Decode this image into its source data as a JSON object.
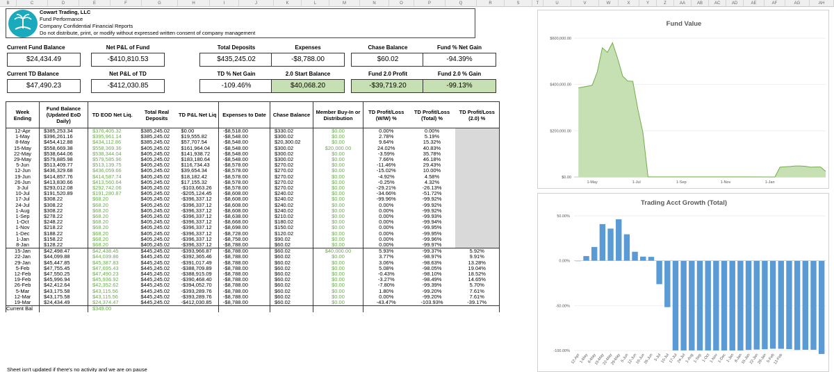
{
  "columns": [
    "B",
    "C",
    "D",
    "E",
    "F",
    "G",
    "H",
    "I",
    "J",
    "K",
    "L",
    "M",
    "N",
    "O",
    "P",
    "Q",
    "R",
    "S",
    "T",
    "U",
    "V",
    "W",
    "X",
    "Y",
    "Z",
    "AA",
    "AB",
    "AC",
    "AD",
    "AE",
    "AF",
    "AG",
    "AH"
  ],
  "header": {
    "company": "Cowart Trading, LLC",
    "line2": "Fund Performance",
    "line3": "Company Confidential Financial Reports",
    "line4": "Do not distribute, print, or modify without expressed written consent of company management"
  },
  "kpis": [
    {
      "label": "Current Fund Balance",
      "value": "$24,434.49",
      "green": false
    },
    {
      "label": "Net P&L of Fund",
      "value": "-$410,810.53",
      "green": false
    },
    {
      "label": "Total Deposits",
      "value": "$435,245.02",
      "green": false
    },
    {
      "label": "Expenses",
      "value": "-$8,788.00",
      "green": false
    },
    {
      "label": "Chase Balance",
      "value": "$60.02",
      "green": false
    },
    {
      "label": "Fund % Net Gain",
      "value": "-94.39%",
      "green": false
    },
    {
      "label": "Current TD Balance",
      "value": "$47,490.23",
      "green": false
    },
    {
      "label": "Net P&L of TD",
      "value": "-$412,030.85",
      "green": false
    },
    {
      "label": "TD % Net Gain",
      "value": "-109.46%",
      "green": false
    },
    {
      "label": "2.0 Start Balance",
      "value": "$40,068.20",
      "green": true
    },
    {
      "label": "Fund 2.0 Profit",
      "value": "-$39,719.20",
      "green": true
    },
    {
      "label": "Fund 2.0 % Gain",
      "value": "-99.13%",
      "green": true
    }
  ],
  "table": {
    "headers": [
      "Week Ending",
      "Fund Balance (Updated EoD Daily)",
      "TD EOD Net Liq.",
      "Total Real Deposits",
      "TD P&L Net Liq",
      "Expenses to Date",
      "Chase Balance",
      "Member Buy-In or Distribution",
      "TD Profit/Loss (W/W) %",
      "TD Profit/Loss (Total) %",
      "TD Profit/Loss (2.0) %"
    ],
    "rows": [
      [
        "12-Apr",
        "$385,253.34",
        "$376,405.32",
        "$385,245.02",
        "$0.00",
        "-$8,518.00",
        "$330.02",
        "$0.00",
        "0.00%",
        "0.00%",
        ""
      ],
      [
        "1-May",
        "$396,261.16",
        "$395,961.14",
        "$385,245.02",
        "$19,555.82",
        "-$8,548.00",
        "$300.02",
        "$0.00",
        "2.78%",
        "5.19%",
        ""
      ],
      [
        "8-May",
        "$454,412.88",
        "$434,112.86",
        "$385,245.02",
        "$57,707.54",
        "-$8,548.00",
        "$20,300.02",
        "$0.00",
        "9.64%",
        "15.32%",
        ""
      ],
      [
        "15-May",
        "$558,669.38",
        "$558,369.36",
        "$405,245.02",
        "$161,964.04",
        "-$8,548.00",
        "$300.02",
        "$20,000.00",
        "24.02%",
        "40.83%",
        ""
      ],
      [
        "22-May",
        "$538,644.06",
        "$538,344.04",
        "$405,245.02",
        "$141,938.72",
        "-$8,548.00",
        "$300.02",
        "$0.00",
        "-3.59%",
        "35.78%",
        ""
      ],
      [
        "29-May",
        "$579,885.98",
        "$579,585.96",
        "$405,245.02",
        "$183,180.64",
        "-$8,548.00",
        "$300.02",
        "$0.00",
        "7.66%",
        "46.18%",
        ""
      ],
      [
        "5-Jun",
        "$513,409.77",
        "$513,139.75",
        "$405,245.02",
        "$116,734.43",
        "-$8,578.00",
        "$270.02",
        "$0.00",
        "-11.46%",
        "29.43%",
        ""
      ],
      [
        "12-Jun",
        "$436,329.68",
        "$436,059.66",
        "$405,245.02",
        "$39,654.34",
        "-$8,578.00",
        "$270.02",
        "$0.00",
        "-15.02%",
        "10.00%",
        ""
      ],
      [
        "19-Jun",
        "$414,857.76",
        "$414,587.74",
        "$405,245.02",
        "$18,182.42",
        "-$8,578.00",
        "$270.02",
        "$0.00",
        "-4.92%",
        "4.58%",
        ""
      ],
      [
        "26-Jun",
        "$413,830.66",
        "$413,560.64",
        "$405,245.02",
        "$17,155.32",
        "-$8,578.00",
        "$270.02",
        "$0.00",
        "-0.25%",
        "4.32%",
        ""
      ],
      [
        "3-Jul",
        "$293,012.08",
        "$292,742.06",
        "$405,245.02",
        "-$103,663.26",
        "-$8,578.00",
        "$270.02",
        "$0.00",
        "-29.21%",
        "-26.13%",
        ""
      ],
      [
        "10-Jul",
        "$191,520.89",
        "$191,280.87",
        "$405,245.02",
        "-$205,124.45",
        "-$8,608.00",
        "$240.02",
        "$0.00",
        "-34.66%",
        "-51.72%",
        ""
      ],
      [
        "17-Jul",
        "$308.22",
        "$68.20",
        "$405,245.02",
        "-$396,337.12",
        "-$8,608.00",
        "$240.02",
        "$0.00",
        "-99.96%",
        "-99.92%",
        ""
      ],
      [
        "24-Jul",
        "$308.22",
        "$68.20",
        "$405,245.02",
        "-$396,337.12",
        "-$8,608.00",
        "$240.02",
        "$0.00",
        "0.00%",
        "-99.92%",
        ""
      ],
      [
        "1-Aug",
        "$308.22",
        "$68.20",
        "$405,245.02",
        "-$396,337.12",
        "-$8,608.00",
        "$240.02",
        "$0.00",
        "0.00%",
        "-99.92%",
        ""
      ],
      [
        "1-Sep",
        "$278.22",
        "$68.20",
        "$405,245.02",
        "-$396,337.12",
        "-$8,638.00",
        "$210.02",
        "$0.00",
        "0.00%",
        "-99.93%",
        ""
      ],
      [
        "1-Oct",
        "$248.22",
        "$68.20",
        "$405,245.02",
        "-$396,337.12",
        "-$8,668.00",
        "$180.02",
        "$0.00",
        "0.00%",
        "-99.94%",
        ""
      ],
      [
        "1-Nov",
        "$218.22",
        "$68.20",
        "$405,245.02",
        "-$396,337.12",
        "-$8,698.00",
        "$150.02",
        "$0.00",
        "0.00%",
        "-99.95%",
        ""
      ],
      [
        "1-Dec",
        "$188.22",
        "$68.20",
        "$405,245.02",
        "-$396,337.12",
        "-$8,728.00",
        "$120.02",
        "$0.00",
        "0.00%",
        "-99.95%",
        ""
      ],
      [
        "1-Jan",
        "$158.22",
        "$68.20",
        "$405,245.02",
        "-$396,337.12",
        "-$8,758.00",
        "$90.02",
        "$0.00",
        "0.00%",
        "-99.96%",
        ""
      ],
      [
        "8-Jan",
        "$128.22",
        "$68.20",
        "$405,245.02",
        "-$396,337.12",
        "-$8,788.00",
        "$60.02",
        "$0.00",
        "0.00%",
        "-99.97%",
        ""
      ],
      [
        "15-Jan",
        "$42,498.47",
        "$42,438.45",
        "$445,245.02",
        "-$393,966.87",
        "-$8,788.00",
        "$60.02",
        "$40,000.00",
        "5.93%",
        "-99.37%",
        "5.92%"
      ],
      [
        "22-Jan",
        "$44,099.88",
        "$44,039.86",
        "$445,245.02",
        "-$392,365.46",
        "-$8,788.00",
        "$60.02",
        "$0.00",
        "3.77%",
        "-98.97%",
        "9.91%"
      ],
      [
        "29-Jan",
        "$45,447.85",
        "$45,387.83",
        "$445,245.02",
        "-$391,017.49",
        "-$8,788.00",
        "$60.02",
        "$0.00",
        "3.06%",
        "-98.63%",
        "13.28%"
      ],
      [
        "5-Feb",
        "$47,755.45",
        "$47,695.43",
        "$445,245.02",
        "-$388,709.89",
        "-$8,788.00",
        "$60.02",
        "$0.00",
        "5.08%",
        "-98.05%",
        "19.04%"
      ],
      [
        "12-Feb",
        "$47,550.25",
        "$47,490.23",
        "$445,245.02",
        "-$388,915.09",
        "-$8,788.00",
        "$60.02",
        "$0.00",
        "-0.43%",
        "-98.10%",
        "18.52%"
      ],
      [
        "19-Feb",
        "$45,996.94",
        "$45,936.92",
        "$445,245.02",
        "-$390,468.40",
        "-$8,788.00",
        "$60.02",
        "$0.00",
        "-3.27%",
        "-98.49%",
        "14.65%"
      ],
      [
        "26-Feb",
        "$42,412.64",
        "$42,352.62",
        "$445,245.02",
        "-$394,052.70",
        "-$8,788.00",
        "$60.02",
        "$0.00",
        "-7.80%",
        "-99.39%",
        "5.70%"
      ],
      [
        "5-Mar",
        "$43,175.58",
        "$43,115.56",
        "$445,245.02",
        "-$393,289.76",
        "-$8,788.00",
        "$60.02",
        "$0.00",
        "1.80%",
        "-99.20%",
        "7.61%"
      ],
      [
        "12-Mar",
        "$43,175.58",
        "$43,115.56",
        "$445,245.02",
        "-$393,289.76",
        "-$8,788.00",
        "$60.02",
        "$0.00",
        "0.00%",
        "-99.20%",
        "7.61%"
      ],
      [
        "19-Mar",
        "$24,434.49",
        "$24,374.47",
        "$445,245.02",
        "-$412,030.85",
        "-$8,788.00",
        "$60.02",
        "$0.00",
        "-43.47%",
        "-103.93%",
        "-39.17%"
      ],
      [
        "Current Bal",
        "",
        "$349.00",
        "",
        "",
        "",
        "",
        "",
        "",
        "",
        ""
      ]
    ]
  },
  "footer_note": "Sheet isn't updated if there's no activity and we are on pause",
  "colors": {
    "fund_area": "#c6e0b4",
    "fund_line": "#70ad47",
    "growth_bar": "#5b9bd5",
    "green_text": "#6aa84f",
    "gray_cell": "#d9d9d9",
    "kpi_green": "#c6e0b4"
  },
  "chart_data": [
    {
      "type": "area",
      "title": "Fund Value",
      "y_tick_labels": [
        "$600,000.00",
        "$400,000.00",
        "$200,000.00",
        "$0.00"
      ],
      "ylim": [
        0,
        600000
      ],
      "x_tick_labels": [
        "1-May",
        "1-Jul",
        "1-Sep",
        "1-Nov",
        "1-Jan"
      ],
      "grid": true,
      "x": [
        "12-Apr",
        "1-May",
        "8-May",
        "15-May",
        "22-May",
        "29-May",
        "5-Jun",
        "12-Jun",
        "19-Jun",
        "26-Jun",
        "3-Jul",
        "10-Jul",
        "17-Jul",
        "24-Jul",
        "1-Aug",
        "1-Sep",
        "1-Oct",
        "1-Nov",
        "1-Dec",
        "1-Jan",
        "8-Jan",
        "15-Jan",
        "22-Jan",
        "29-Jan",
        "5-Feb",
        "12-Feb",
        "19-Feb",
        "26-Feb",
        "5-Mar",
        "12-Mar",
        "19-Mar"
      ],
      "values": [
        385253.34,
        396261.16,
        454412.88,
        558669.38,
        538644.06,
        579885.98,
        513409.77,
        436329.68,
        414857.76,
        413830.66,
        293012.08,
        191520.89,
        308.22,
        308.22,
        308.22,
        278.22,
        248.22,
        218.22,
        188.22,
        158.22,
        128.22,
        42498.47,
        44099.88,
        45447.85,
        47755.45,
        47550.25,
        45996.94,
        42412.64,
        43175.58,
        43175.58,
        24434.49
      ]
    },
    {
      "type": "bar",
      "title": "Trading Acct Growth (Total)",
      "y_tick_labels": [
        "50.00%",
        "0.00%",
        "-50.00%",
        "-100.00%"
      ],
      "ylim": [
        -100,
        50
      ],
      "grid": true,
      "categories": [
        "12-Apr",
        "1-May",
        "8-May",
        "15-May",
        "22-May",
        "29-May",
        "5-Jun",
        "12-Jun",
        "19-Jun",
        "26-Jun",
        "3-Jul",
        "10-Jul",
        "17-Jul",
        "24-Jul",
        "1-Aug",
        "1-Sep",
        "1-Oct",
        "1-Nov",
        "1-Dec",
        "1-Jan",
        "8-Jan",
        "15-Jan",
        "22-Jan",
        "29-Jan",
        "5-Feb",
        "12-Feb"
      ],
      "values": [
        0.0,
        5.19,
        15.32,
        40.83,
        35.78,
        46.18,
        29.43,
        10.0,
        4.58,
        4.32,
        -26.13,
        -51.72,
        -99.92,
        -99.92,
        -99.92,
        -99.93,
        -99.94,
        -99.95,
        -99.95,
        -99.96,
        -99.97,
        -99.37,
        -98.97,
        -98.63,
        -98.05,
        -98.1,
        -98.49,
        -99.39,
        -99.2,
        -99.2,
        -103.93
      ]
    }
  ]
}
